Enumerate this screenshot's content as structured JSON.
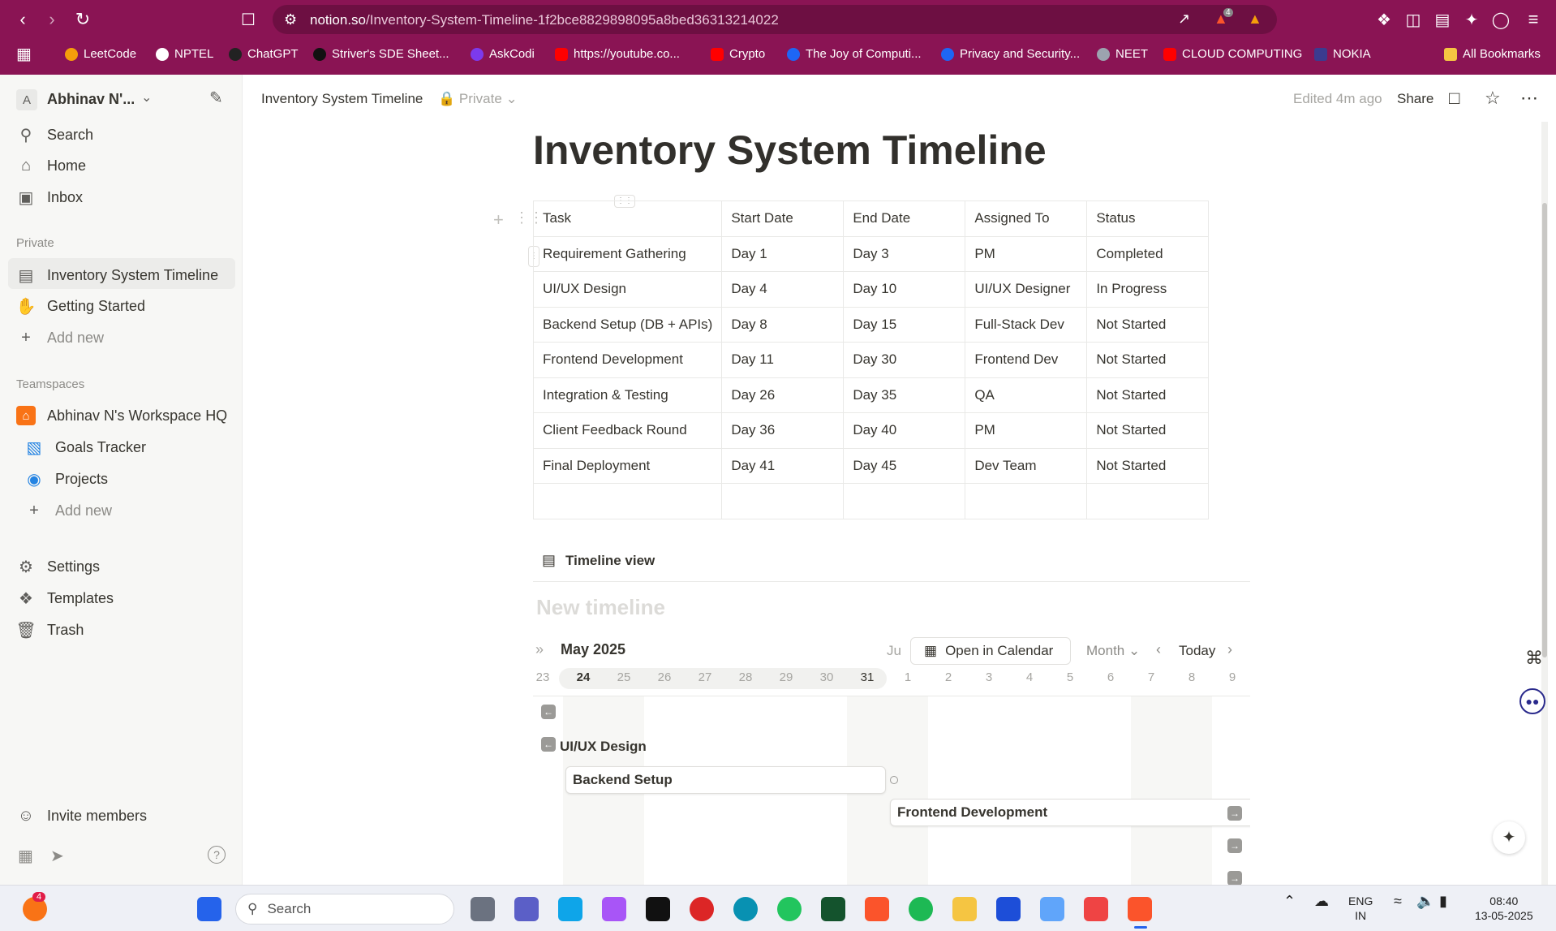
{
  "browser": {
    "url_host": "notion.so",
    "url_path": "/Inventory-System-Timeline-1f2bce8829898095a8bed36313214022",
    "bookmarks": [
      {
        "label": "LeetCode",
        "color": "#f59e0b"
      },
      {
        "label": "NPTEL",
        "color": "#ffffff"
      },
      {
        "label": "ChatGPT",
        "color": "#222222"
      },
      {
        "label": "Striver's SDE Sheet...",
        "color": "#111111"
      },
      {
        "label": "AskCodi",
        "color": "#7c3aed"
      },
      {
        "label": "https://youtube.co...",
        "color": "#ff0000"
      },
      {
        "label": "Crypto",
        "color": "#ff0000"
      },
      {
        "label": "The Joy of Computi...",
        "color": "#1e66f5"
      },
      {
        "label": "Privacy and Security...",
        "color": "#1e66f5"
      },
      {
        "label": "NEET",
        "color": "#9ca3af"
      },
      {
        "label": "CLOUD COMPUTING",
        "color": "#ff0000"
      },
      {
        "label": "NOKIA",
        "color": "#3b3b8f"
      }
    ],
    "all_bookmarks": "All Bookmarks",
    "brave_badge": "4"
  },
  "sidebar": {
    "workspace": "Abhinav N'...",
    "workspace_avatar": "A",
    "nav": {
      "search": "Search",
      "home": "Home",
      "inbox": "Inbox"
    },
    "private_label": "Private",
    "private_pages": [
      "Inventory System Timeline",
      "Getting Started"
    ],
    "add_new": "Add new",
    "teamspaces_label": "Teamspaces",
    "teamspace": "Abhinav N's Workspace HQ",
    "team_pages": [
      "Goals Tracker",
      "Projects"
    ],
    "settings": "Settings",
    "templates": "Templates",
    "trash": "Trash",
    "invite": "Invite members"
  },
  "header": {
    "breadcrumb": "Inventory System Timeline",
    "privacy": "Private",
    "edited": "Edited 4m ago",
    "share": "Share"
  },
  "page": {
    "title": "Inventory System Timeline",
    "table": {
      "columns": [
        "Task",
        "Start Date",
        "End Date",
        "Assigned To",
        "Status"
      ],
      "rows": [
        [
          "Requirement Gathering",
          "Day 1",
          "Day 3",
          "PM",
          "Completed"
        ],
        [
          "UI/UX Design",
          "Day 4",
          "Day 10",
          "UI/UX Designer",
          "In Progress"
        ],
        [
          "Backend Setup (DB + APIs)",
          "Day 8",
          "Day 15",
          "Full-Stack Dev",
          "Not Started"
        ],
        [
          "Frontend Development",
          "Day 11",
          "Day 30",
          "Frontend Dev",
          "Not Started"
        ],
        [
          "Integration & Testing",
          "Day 26",
          "Day 35",
          "QA",
          "Not Started"
        ],
        [
          "Client Feedback Round",
          "Day 36",
          "Day 40",
          "PM",
          "Not Started"
        ],
        [
          "Final Deployment",
          "Day 41",
          "Day 45",
          "Dev Team",
          "Not Started"
        ]
      ]
    },
    "timeline": {
      "view_label": "Timeline view",
      "placeholder": "New timeline",
      "month": "May 2025",
      "next_month_partial": "Ju",
      "open_calendar": "Open in Calendar",
      "scale": "Month",
      "today": "Today",
      "days": [
        "23",
        "24",
        "25",
        "26",
        "27",
        "28",
        "29",
        "30",
        "31",
        "1",
        "2",
        "3",
        "4",
        "5",
        "6",
        "7",
        "8",
        "9"
      ],
      "today_day": "24",
      "items": [
        "UI/UX Design",
        "Backend Setup",
        "Frontend Development"
      ]
    }
  },
  "taskbar": {
    "search": "Search",
    "notif_count": "4",
    "lang": "ENG",
    "region": "IN",
    "time": "08:40",
    "date": "13-05-2025"
  }
}
